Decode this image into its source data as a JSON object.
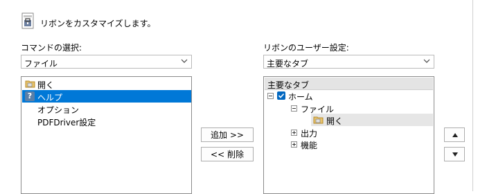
{
  "header": {
    "title": "リボンをカスタマイズします。",
    "icon": "ribbon-customize-icon"
  },
  "left": {
    "label": "コマンドの選択:",
    "dropdown_value": "ファイル",
    "items": [
      {
        "label": "開く",
        "icon": "open-folder-icon",
        "selected": false
      },
      {
        "label": "ヘルプ",
        "icon": "help-icon",
        "selected": true
      },
      {
        "label": "オプション",
        "icon": "",
        "selected": false
      },
      {
        "label": "PDFDriver設定",
        "icon": "",
        "selected": false
      }
    ]
  },
  "buttons": {
    "add": "追加 >>",
    "remove": "<< 削除"
  },
  "right": {
    "label": "リボンのユーザー設定:",
    "dropdown_value": "主要なタブ",
    "tree_header": "主要なタブ",
    "tree": {
      "home": "ホーム",
      "file": "ファイル",
      "open": "開く",
      "output": "出力",
      "function": "機能"
    }
  },
  "colors": {
    "selection": "#0078d7",
    "checkbox": "#0067c0"
  }
}
